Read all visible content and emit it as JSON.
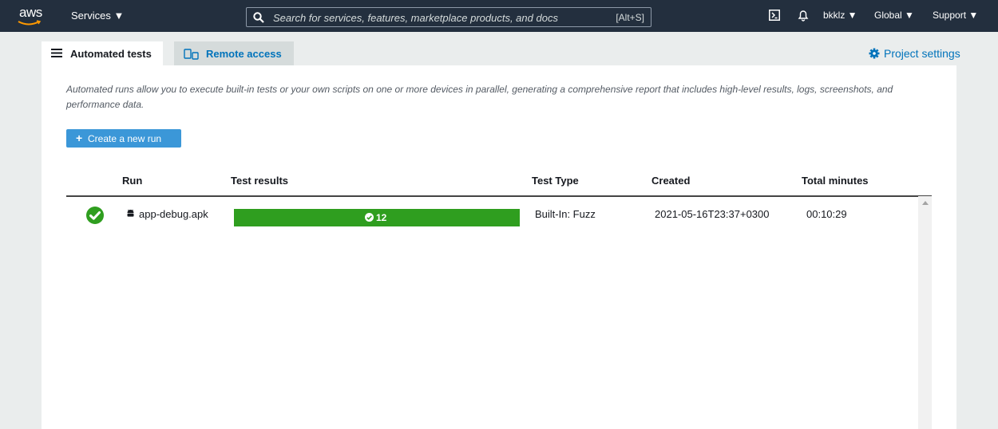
{
  "topnav": {
    "logo_text": "aws",
    "services_label": "Services ▼",
    "search_placeholder": "Search for services, features, marketplace products, and docs",
    "search_shortcut": "[Alt+S]",
    "user_label": "bkklz ▼",
    "region_label": "Global ▼",
    "support_label": "Support ▼"
  },
  "tabs": [
    {
      "label": "Automated tests",
      "icon": "list-icon",
      "active": true
    },
    {
      "label": "Remote access",
      "icon": "devices-icon",
      "active": false
    }
  ],
  "project_settings_label": "Project settings",
  "description": "Automated runs allow you to execute built-in tests or your own scripts on one or more devices in parallel, generating a comprehensive report that includes high-level results, logs, screenshots, and performance data.",
  "create_button_label": "Create a new run",
  "table": {
    "columns": [
      "Run",
      "Test results",
      "Test Type",
      "Created",
      "Total minutes"
    ],
    "rows": [
      {
        "status": "passed",
        "run": "app-debug.apk",
        "passed_count": "12",
        "test_type": "Built-In: Fuzz",
        "created": "2021-05-16T23:37+0300",
        "total_minutes": "00:10:29"
      }
    ]
  },
  "colors": {
    "nav_bg": "#232f3e",
    "accent_blue": "#0073bb",
    "button_blue": "#3b97d8",
    "success_green": "#2f9e1f"
  }
}
